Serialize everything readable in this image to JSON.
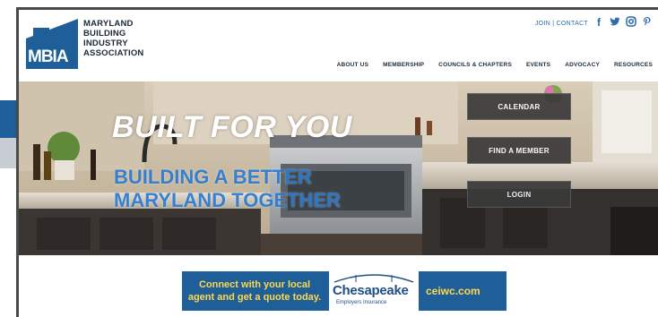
{
  "logo": {
    "abbrev": "MBIA",
    "lines": [
      "MARYLAND",
      "BUILDING",
      "INDUSTRY",
      "ASSOCIATION"
    ]
  },
  "top_links": {
    "join": "JOIN",
    "separator": " | ",
    "contact": "CONTACT"
  },
  "social": [
    {
      "icon": "facebook-icon",
      "glyph": "f"
    },
    {
      "icon": "twitter-icon",
      "glyph": "🐦"
    },
    {
      "icon": "instagram-icon",
      "glyph": "◎"
    },
    {
      "icon": "pinterest-icon",
      "glyph": "P"
    }
  ],
  "nav": [
    "ABOUT US",
    "MEMBERSHIP",
    "COUNCILS & CHAPTERS",
    "EVENTS",
    "ADVOCACY",
    "RESOURCES"
  ],
  "hero": {
    "title": "BUILT FOR YOU",
    "subtitle_line1": "BUILDING A BETTER",
    "subtitle_line2": "MARYLAND TOGETHER"
  },
  "cta": [
    "CALENDAR",
    "FIND A MEMBER",
    "LOGIN"
  ],
  "ad": {
    "line1": "Connect with your local",
    "line2": "agent and get a quote today.",
    "brand": "Chesapeake",
    "brand_sub": "Employers Insurance",
    "url": "ceiwc.com"
  },
  "colors": {
    "brand_blue": "#1f5f99",
    "ad_yellow": "#ffd84a",
    "link_blue": "#2a6bb0"
  }
}
